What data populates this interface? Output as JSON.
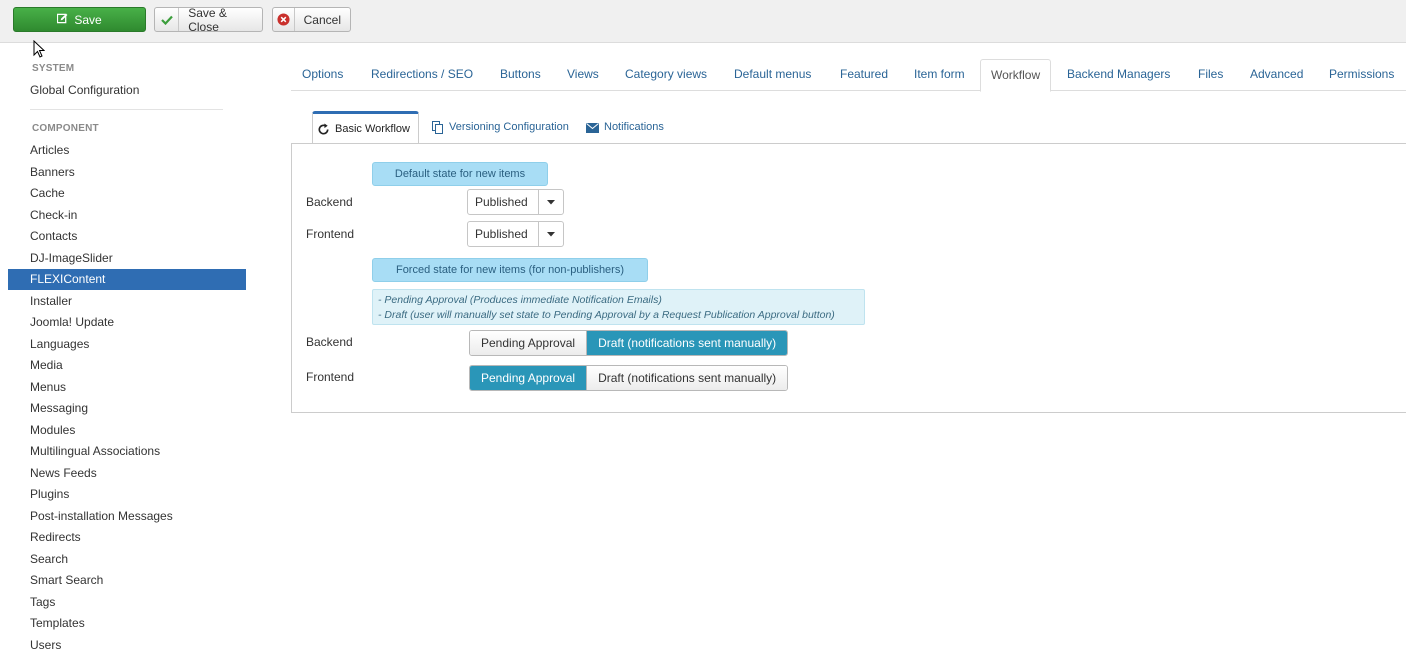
{
  "toolbar": {
    "save_label": "Save",
    "save_close_label": "Save & Close",
    "cancel_label": "Cancel"
  },
  "sidebar": {
    "system_header": "SYSTEM",
    "system_items": [
      "Global Configuration"
    ],
    "component_header": "COMPONENT",
    "items": [
      "Articles",
      "Banners",
      "Cache",
      "Check-in",
      "Contacts",
      "DJ-ImageSlider",
      "FLEXIContent",
      "Installer",
      "Joomla! Update",
      "Languages",
      "Media",
      "Menus",
      "Messaging",
      "Modules",
      "Multilingual Associations",
      "News Feeds",
      "Plugins",
      "Post-installation Messages",
      "Redirects",
      "Search",
      "Smart Search",
      "Tags",
      "Templates",
      "Users"
    ],
    "active_item": "FLEXIContent"
  },
  "tabs": [
    "Options",
    "Redirections / SEO",
    "Buttons",
    "Views",
    "Category views",
    "Default menus",
    "Featured",
    "Item form",
    "Workflow",
    "Backend Managers",
    "Files",
    "Advanced",
    "Permissions"
  ],
  "active_tab": "Workflow",
  "subtabs": [
    {
      "label": "Basic Workflow",
      "icon": "refresh-icon"
    },
    {
      "label": "Versioning Configuration",
      "icon": "copy-icon"
    },
    {
      "label": "Notifications",
      "icon": "envelope-icon"
    }
  ],
  "active_subtab": "Basic Workflow",
  "workflow": {
    "default_state_label": "Default state for new items",
    "backend_label": "Backend",
    "frontend_label": "Frontend",
    "backend_default": "Published",
    "frontend_default": "Published",
    "forced_state_label": "Forced state for new items (for non-publishers)",
    "note_line1": "- Pending Approval (Produces immediate Notification Emails)",
    "note_line2": "- Draft (user will manually set state to Pending Approval by a Request Publication Approval button)",
    "option_pending": "Pending Approval",
    "option_draft": "Draft (notifications sent manually)",
    "backend_forced_selected": "Draft (notifications sent manually)",
    "frontend_forced_selected": "Pending Approval"
  },
  "colors": {
    "save_green": "#3c9e3c",
    "sidebar_active": "#2f6db3",
    "toggle_active": "#2a96b8",
    "info_label_bg": "#a8ddf5",
    "link_blue": "#2a6496"
  }
}
